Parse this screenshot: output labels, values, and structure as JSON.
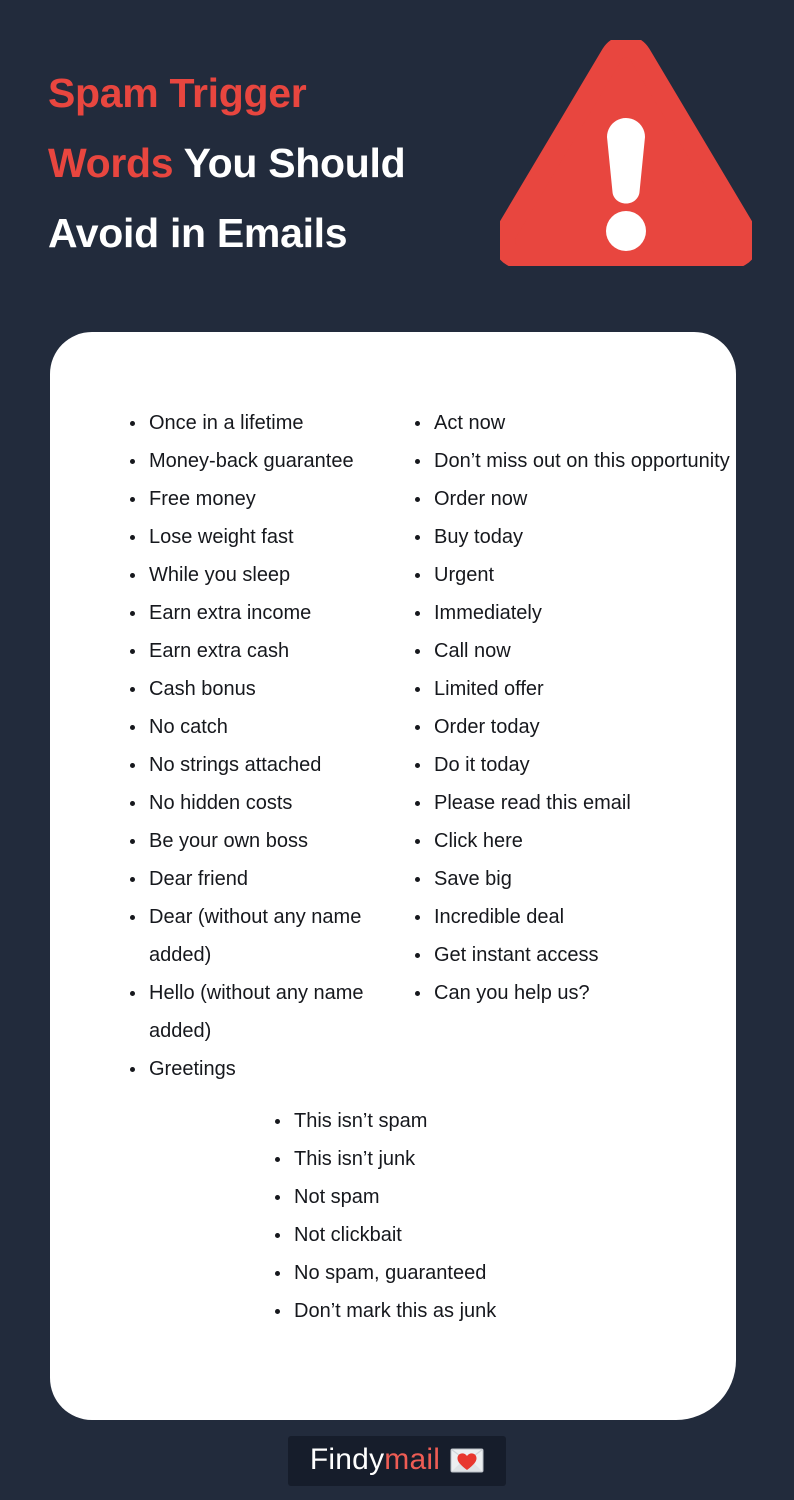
{
  "theme": {
    "background": "#222b3c",
    "card_background": "#ffffff",
    "accent_red": "#e8463f",
    "list_red": "#ee5c54",
    "list_blue": "#9dc6f2",
    "text_dark": "#16181d",
    "badge_background": "#161d2b"
  },
  "header": {
    "title_part_1": "Spam Trigger",
    "title_part_2": "Words",
    "title_part_3": " You Should",
    "title_part_4": "Avoid in Emails",
    "icon": "warning-triangle-icon"
  },
  "lists": {
    "left": [
      {
        "text": "Once in a lifetime",
        "color": "dark",
        "bullet": "dark"
      },
      {
        "text": "Money-back guarantee",
        "color": "dark",
        "bullet": "dark"
      },
      {
        "text": "Free money",
        "color": "dark",
        "bullet": "dark"
      },
      {
        "text": "Lose weight fast",
        "color": "dark",
        "bullet": "dark"
      },
      {
        "text": "While you sleep",
        "color": "dark",
        "bullet": "dark"
      },
      {
        "text": "Earn extra income",
        "color": "dark",
        "bullet": "dark"
      },
      {
        "text": "Earn extra cash",
        "color": "dark",
        "bullet": "dark"
      },
      {
        "text": "Cash bonus",
        "color": "dark",
        "bullet": "dark"
      },
      {
        "text": "No catch",
        "color": "dark",
        "bullet": "dark"
      },
      {
        "text": "No strings attached",
        "color": "dark",
        "bullet": "dark"
      },
      {
        "text": "No hidden costs",
        "color": "dark",
        "bullet": "dark"
      },
      {
        "text": "Be your own boss",
        "color": "dark",
        "bullet": "dark"
      },
      {
        "text": "Dear friend",
        "color": "red",
        "bullet": "red"
      },
      {
        "text": "Dear (without any name added)",
        "color": "red",
        "bullet": "red"
      },
      {
        "text": "Hello (without any name added)",
        "color": "red",
        "bullet": "red"
      },
      {
        "text": "Greetings",
        "color": "red",
        "bullet": "dark"
      }
    ],
    "right": [
      {
        "text": "Act now",
        "color": "blue",
        "bullet": "blue"
      },
      {
        "text": "Don’t miss out on this opportunity",
        "color": "blue",
        "bullet": "blue"
      },
      {
        "text": "Order now",
        "color": "blue",
        "bullet": "blue"
      },
      {
        "text": "Buy today",
        "color": "blue",
        "bullet": "blue"
      },
      {
        "text": "Urgent",
        "color": "blue",
        "bullet": "blue"
      },
      {
        "text": "Immediately",
        "color": "blue",
        "bullet": "blue"
      },
      {
        "text": "Call now",
        "color": "blue",
        "bullet": "blue"
      },
      {
        "text": "Limited offer",
        "color": "blue",
        "bullet": "dark"
      },
      {
        "text": "Order today",
        "color": "dark",
        "bullet": "dark"
      },
      {
        "text": "Do it today",
        "color": "dark",
        "bullet": "dark"
      },
      {
        "text": "Please read this email",
        "color": "dark",
        "bullet": "dark"
      },
      {
        "text": "Click here",
        "color": "dark",
        "bullet": "dark"
      },
      {
        "text": "Save big",
        "color": "dark",
        "bullet": "dark"
      },
      {
        "text": "Incredible deal",
        "color": "dark",
        "bullet": "dark"
      },
      {
        "text": "Get instant access",
        "color": "dark",
        "bullet": "dark"
      },
      {
        "text": "Can you help us?",
        "color": "dark",
        "bullet": "dark"
      }
    ],
    "bottom": [
      {
        "text": "This isn’t spam",
        "color": "dark",
        "bullet": "dark"
      },
      {
        "text": "This isn’t junk",
        "color": "dark",
        "bullet": "dark"
      },
      {
        "text": "Not spam",
        "color": "dark",
        "bullet": "dark"
      },
      {
        "text": "Not clickbait",
        "color": "dark",
        "bullet": "dark"
      },
      {
        "text": "No spam, guaranteed",
        "color": "dark",
        "bullet": "dark"
      },
      {
        "text": "Don’t mark this as junk",
        "color": "dark",
        "bullet": "dark"
      }
    ]
  },
  "footer": {
    "brand_name_part_1": "Findy",
    "brand_name_part_2": "mail",
    "icon": "love-letter-envelope-icon"
  }
}
